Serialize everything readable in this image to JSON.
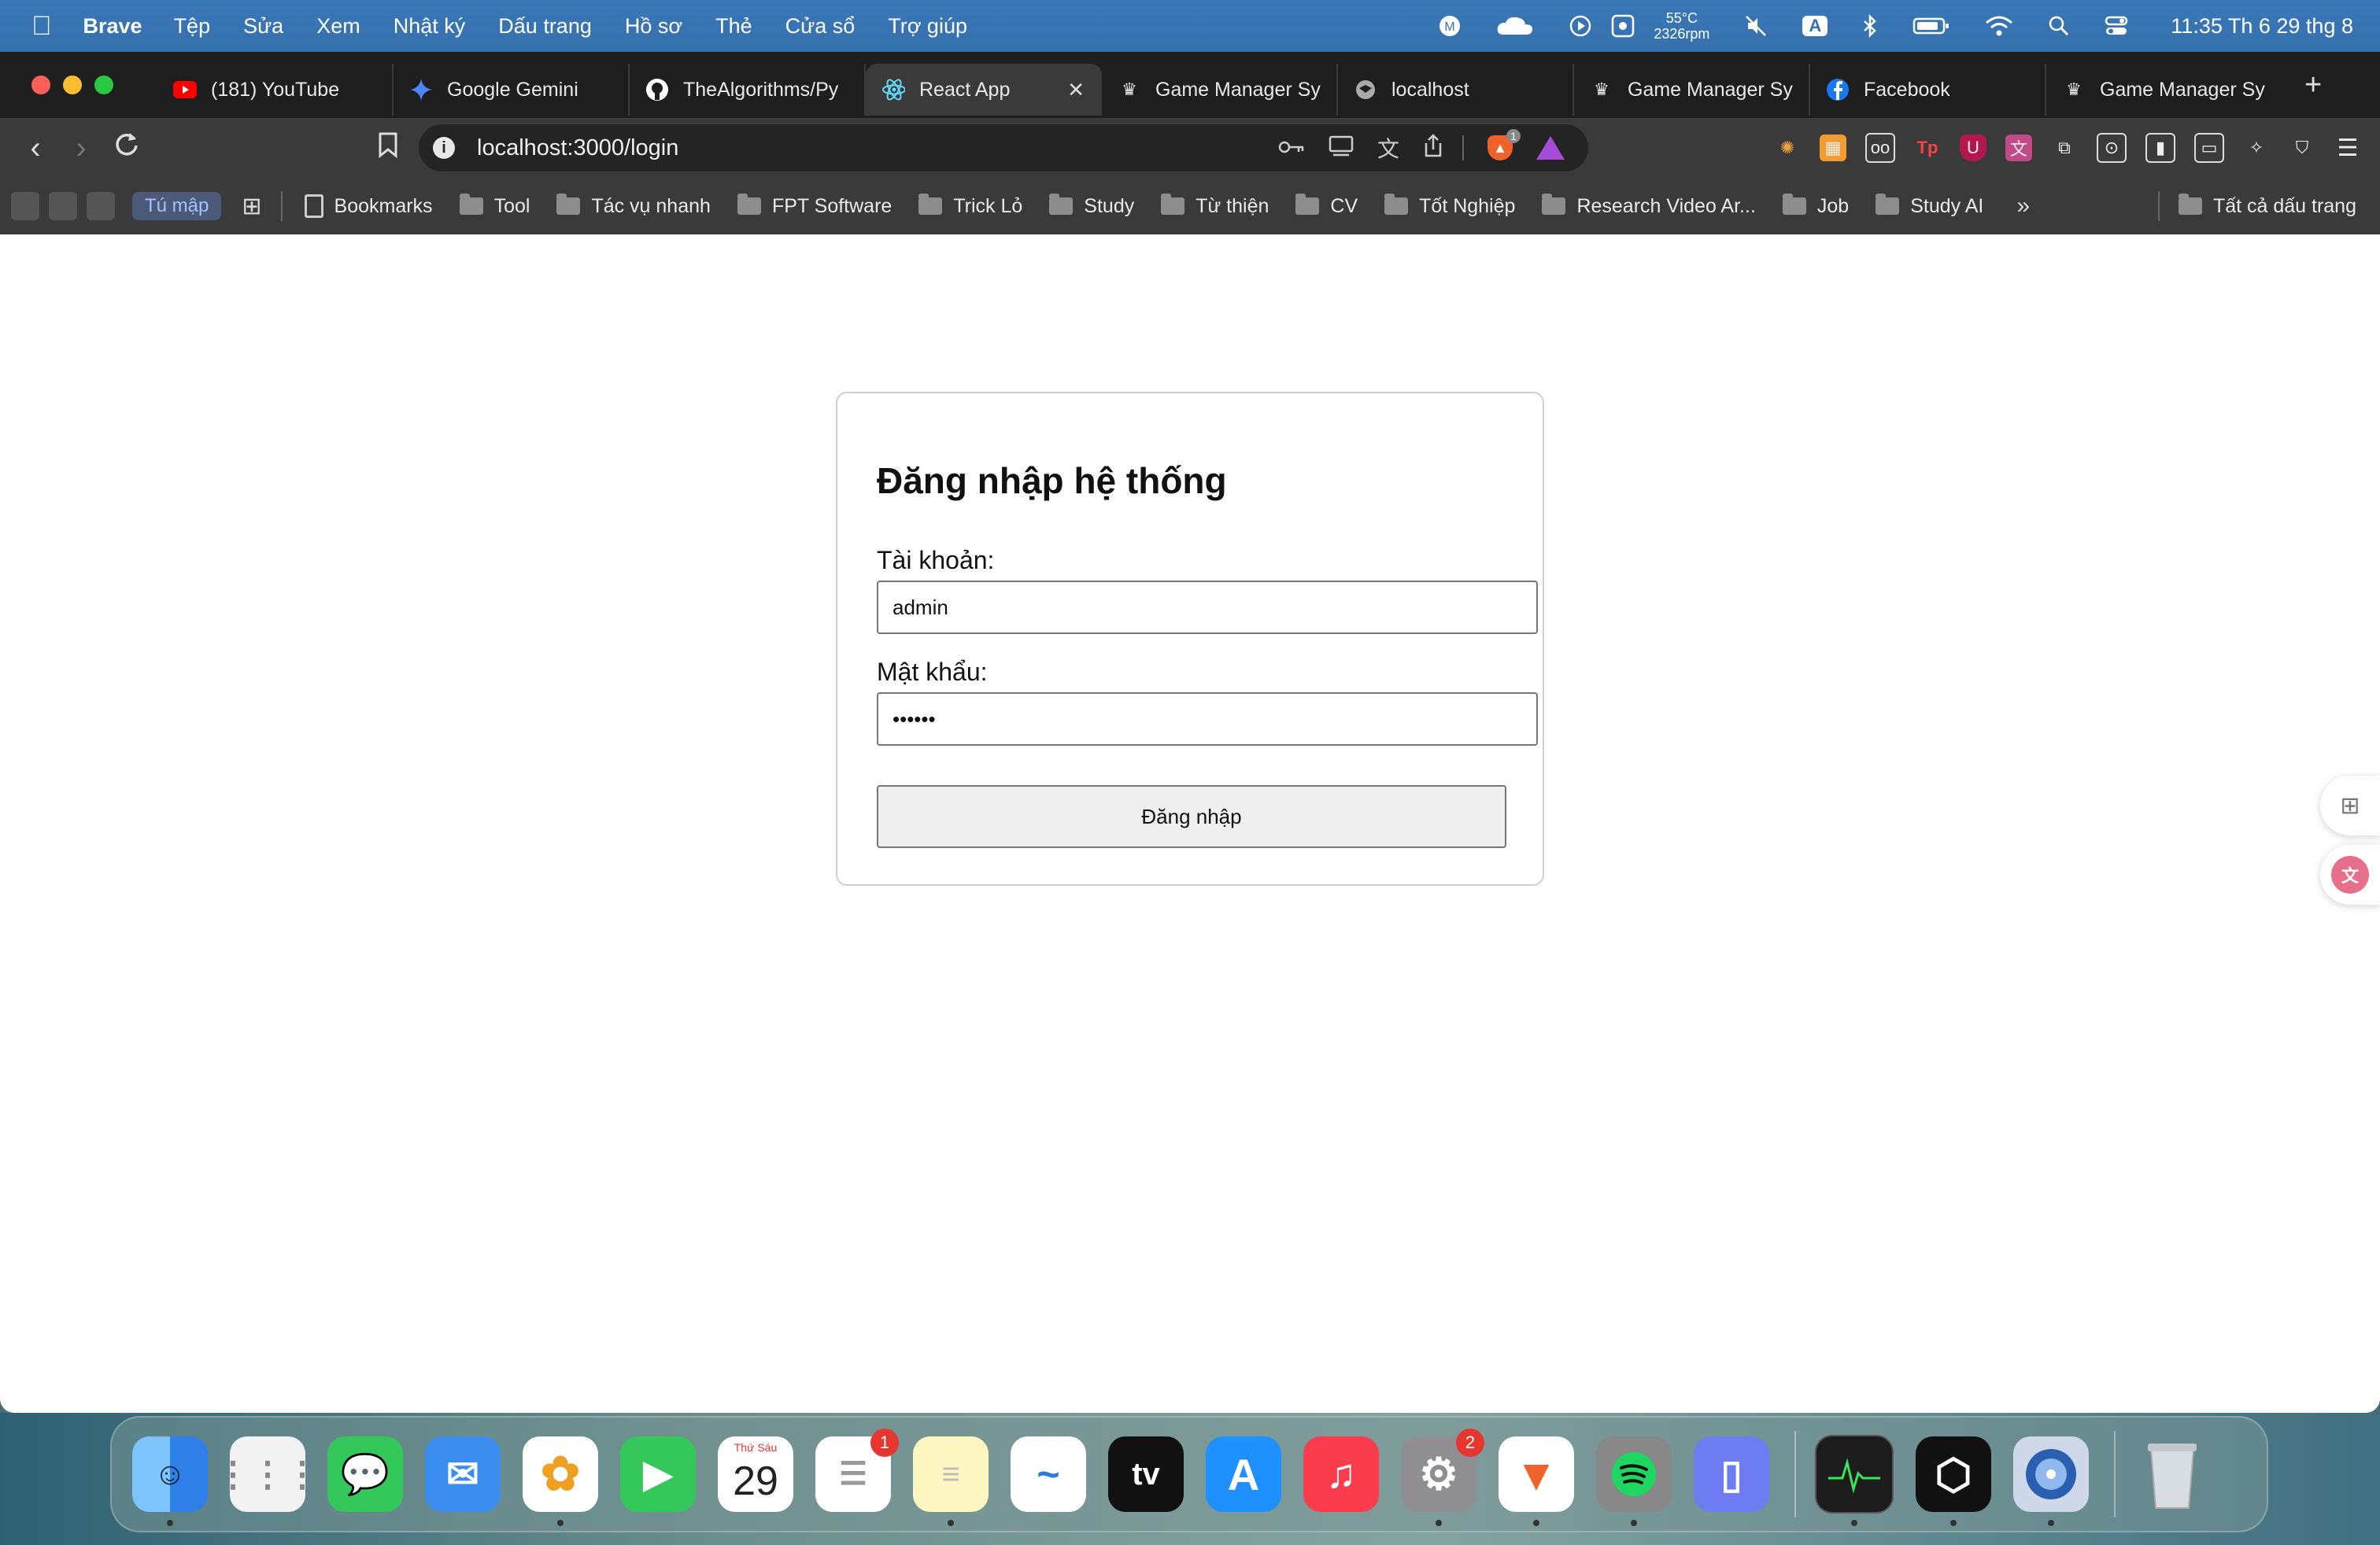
{
  "menubar": {
    "app_name": "Brave",
    "items": [
      "Tệp",
      "Sửa",
      "Xem",
      "Nhật ký",
      "Dấu trang",
      "Hồ sơ",
      "Thẻ",
      "Cửa sổ",
      "Trợ giúp"
    ],
    "temperature": "55°C",
    "fan_speed": "2326rpm",
    "input_source": "A",
    "clock": "11:35 Th 6 29 thg 8"
  },
  "tabs": [
    {
      "title": "(181) YouTube",
      "icon": "youtube-icon",
      "color": "#ff0000"
    },
    {
      "title": "Google Gemini",
      "icon": "gemini-icon",
      "color": "#4f86f7"
    },
    {
      "title": "TheAlgorithms/Py",
      "icon": "github-icon",
      "color": "#ffffff"
    },
    {
      "title": "React App",
      "icon": "react-icon",
      "color": "#61dafb",
      "active": true
    },
    {
      "title": "Game Manager Sy",
      "icon": "crown-icon",
      "color": "#ffffff"
    },
    {
      "title": "localhost",
      "icon": "globe-icon",
      "color": "#cccccc"
    },
    {
      "title": "Game Manager Sy",
      "icon": "crown-icon",
      "color": "#ffffff"
    },
    {
      "title": "Facebook",
      "icon": "facebook-icon",
      "color": "#1877f2"
    },
    {
      "title": "Game Manager Sy",
      "icon": "crown-icon",
      "color": "#ffffff"
    }
  ],
  "toolbar": {
    "url": "localhost:3000/login",
    "shield_badge": "1"
  },
  "bookmarks": {
    "tumap": "Tú mập",
    "items": [
      "Bookmarks",
      "Tool",
      "Tác vụ nhanh",
      "FPT Software",
      "Trick Lỏ",
      "Study",
      "Từ thiện",
      "CV",
      "Tốt Nghiệp",
      "Research Video Ar...",
      "Job",
      "Study AI"
    ],
    "all": "Tất cả dấu trang",
    "more": "»"
  },
  "login": {
    "title": "Đăng nhập hệ thống",
    "username_label": "Tài khoản:",
    "username_value": "admin",
    "password_label": "Mật khẩu:",
    "password_value": "••••••",
    "submit_label": "Đăng nhập"
  },
  "dock": {
    "apps": [
      {
        "name": "finder",
        "color": "#3b8ef0"
      },
      {
        "name": "launchpad",
        "color": "#eeeeee"
      },
      {
        "name": "messages",
        "color": "#34c759"
      },
      {
        "name": "mail",
        "color": "#3b8ef0"
      },
      {
        "name": "photos",
        "color": "#ffffff"
      },
      {
        "name": "facetime",
        "color": "#34c759"
      },
      {
        "name": "calendar",
        "color": "#ffffff",
        "day": "Thứ Sáu",
        "date": "29"
      },
      {
        "name": "reminders",
        "color": "#ffffff",
        "badge": "1"
      },
      {
        "name": "notes",
        "color": "#fff7c2"
      },
      {
        "name": "freeform",
        "color": "#ffffff"
      },
      {
        "name": "apple-tv",
        "color": "#111111",
        "label": "tv"
      },
      {
        "name": "app-store",
        "color": "#1e90ff"
      },
      {
        "name": "music",
        "color": "#fa3c4c"
      },
      {
        "name": "system-settings",
        "color": "#8e8e93",
        "badge": "2"
      },
      {
        "name": "brave",
        "color": "#ffffff"
      },
      {
        "name": "spotify",
        "color": "#888888"
      },
      {
        "name": "simulator",
        "color": "#6d7cf0"
      },
      {
        "name": "activity-monitor",
        "color": "#1c1c1c"
      },
      {
        "name": "unity",
        "color": "#111111"
      },
      {
        "name": "disk-utility",
        "color": "#cfd8e8"
      },
      {
        "name": "trash",
        "color": "#d8dde2"
      }
    ]
  }
}
